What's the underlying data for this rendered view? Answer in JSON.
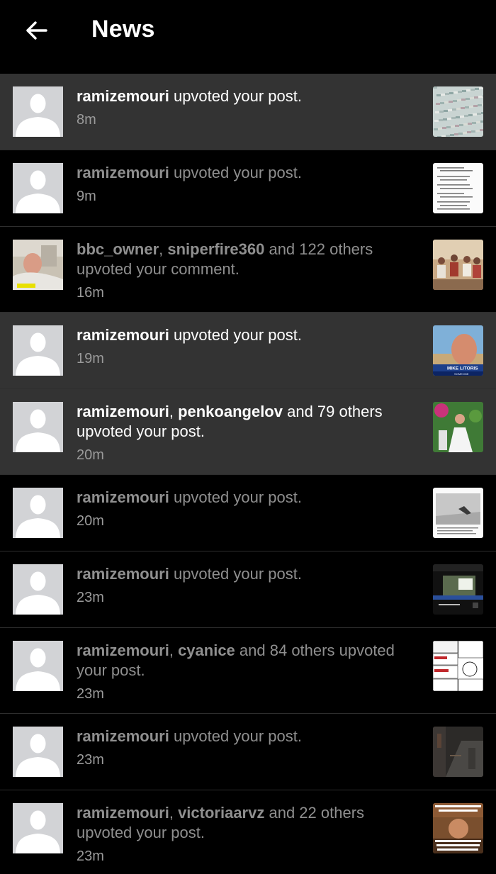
{
  "header": {
    "title": "News"
  },
  "notifications": [
    {
      "users": [
        "ramizemouri"
      ],
      "others": "",
      "action": "upvoted your post.",
      "time": "8m",
      "unread": true,
      "avatar": "default-avatar",
      "thumb": "abstract-pattern"
    },
    {
      "users": [
        "ramizemouri"
      ],
      "others": "",
      "action": "upvoted your post.",
      "time": "9m",
      "unread": false,
      "avatar": "default-avatar",
      "thumb": "text-document"
    },
    {
      "users": [
        "bbc_owner",
        "sniperfire360"
      ],
      "others": "122 others",
      "action": "upvoted your comment.",
      "time": "16m",
      "unread": false,
      "avatar": "photo-man-in-bed",
      "thumb": "group-photo-sepia"
    },
    {
      "users": [
        "ramizemouri"
      ],
      "others": "",
      "action": "upvoted your post.",
      "time": "19m",
      "unread": true,
      "avatar": "default-avatar",
      "thumb": "news-caption-face",
      "thumb_caption": "MIKE LITORIS",
      "thumb_subcaption": "SOMEONE"
    },
    {
      "users": [
        "ramizemouri",
        "penkoangelov"
      ],
      "others": "79 others",
      "action": "upvoted your post.",
      "time": "20m",
      "unread": true,
      "avatar": "default-avatar",
      "thumb": "wedding-photo"
    },
    {
      "users": [
        "ramizemouri"
      ],
      "others": "",
      "action": "upvoted your post.",
      "time": "20m",
      "unread": false,
      "avatar": "default-avatar",
      "thumb": "newspaper-photo"
    },
    {
      "users": [
        "ramizemouri"
      ],
      "others": "",
      "action": "upvoted your post.",
      "time": "23m",
      "unread": false,
      "avatar": "default-avatar",
      "thumb": "app-screenshot"
    },
    {
      "users": [
        "ramizemouri",
        "cyanice"
      ],
      "others": "84 others",
      "action": "upvoted your post.",
      "time": "23m",
      "unread": false,
      "avatar": "default-avatar",
      "thumb": "rage-comic"
    },
    {
      "users": [
        "ramizemouri"
      ],
      "others": "",
      "action": "upvoted your post.",
      "time": "23m",
      "unread": false,
      "avatar": "default-avatar",
      "thumb": "dark-street"
    },
    {
      "users": [
        "ramizemouri",
        "victoriaarvz"
      ],
      "others": "22 others",
      "action": "upvoted your post.",
      "time": "23m",
      "unread": false,
      "avatar": "default-avatar",
      "thumb": "meme-caption"
    }
  ],
  "colors": {
    "background": "#000000",
    "unread_row": "#333333",
    "avatar_bg": "#d2d3d6",
    "read_text": "#8f8f8f"
  }
}
